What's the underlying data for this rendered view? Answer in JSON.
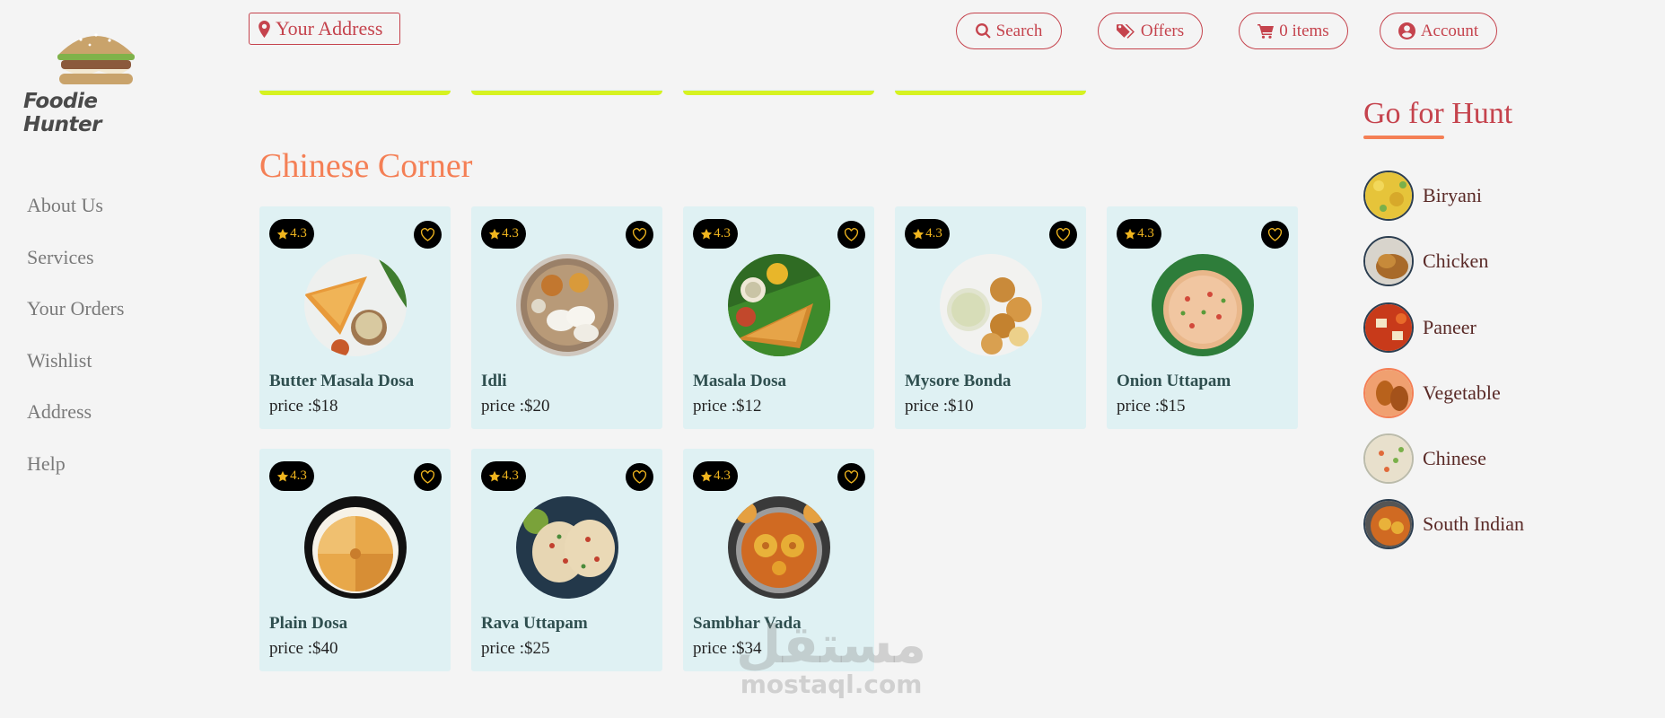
{
  "brand": {
    "name": "Foodie Hunter",
    "logo_icon": "burger-logo"
  },
  "sidebar": {
    "items": [
      {
        "label": "About Us"
      },
      {
        "label": "Services"
      },
      {
        "label": "Your Orders"
      },
      {
        "label": "Wishlist"
      },
      {
        "label": "Address"
      },
      {
        "label": "Help"
      }
    ]
  },
  "topbar": {
    "address_label": "Your Address",
    "search_label": "Search",
    "offers_label": "Offers",
    "cart_label": "0 items",
    "account_label": "Account"
  },
  "section": {
    "title": "Chinese Corner",
    "items": [
      {
        "name": "Butter Masala Dosa",
        "price": "price :$18",
        "rating": "4.3"
      },
      {
        "name": "Idli",
        "price": "price :$20",
        "rating": "4.3"
      },
      {
        "name": "Masala Dosa",
        "price": "price :$12",
        "rating": "4.3"
      },
      {
        "name": "Mysore Bonda",
        "price": "price :$10",
        "rating": "4.3"
      },
      {
        "name": "Onion Uttapam",
        "price": "price :$15",
        "rating": "4.3"
      },
      {
        "name": "Plain Dosa",
        "price": "price :$40",
        "rating": "4.3"
      },
      {
        "name": "Rava Uttapam",
        "price": "price :$25",
        "rating": "4.3"
      },
      {
        "name": "Sambhar Vada",
        "price": "price :$34",
        "rating": "4.3"
      }
    ]
  },
  "hunt": {
    "title": "Go for Hunt",
    "items": [
      {
        "label": "Biryani"
      },
      {
        "label": "Chicken"
      },
      {
        "label": "Paneer"
      },
      {
        "label": "Vegetable"
      },
      {
        "label": "Chinese"
      },
      {
        "label": "South Indian"
      }
    ]
  },
  "watermark": {
    "arabic": "مستقل",
    "latin": "mostaql.com"
  },
  "colors": {
    "accent_red": "#c5434d",
    "accent_orange": "#f47f55",
    "card_bg": "#dff1f3",
    "star_yellow": "#f0b51e",
    "stub_border": "#d6f221"
  }
}
